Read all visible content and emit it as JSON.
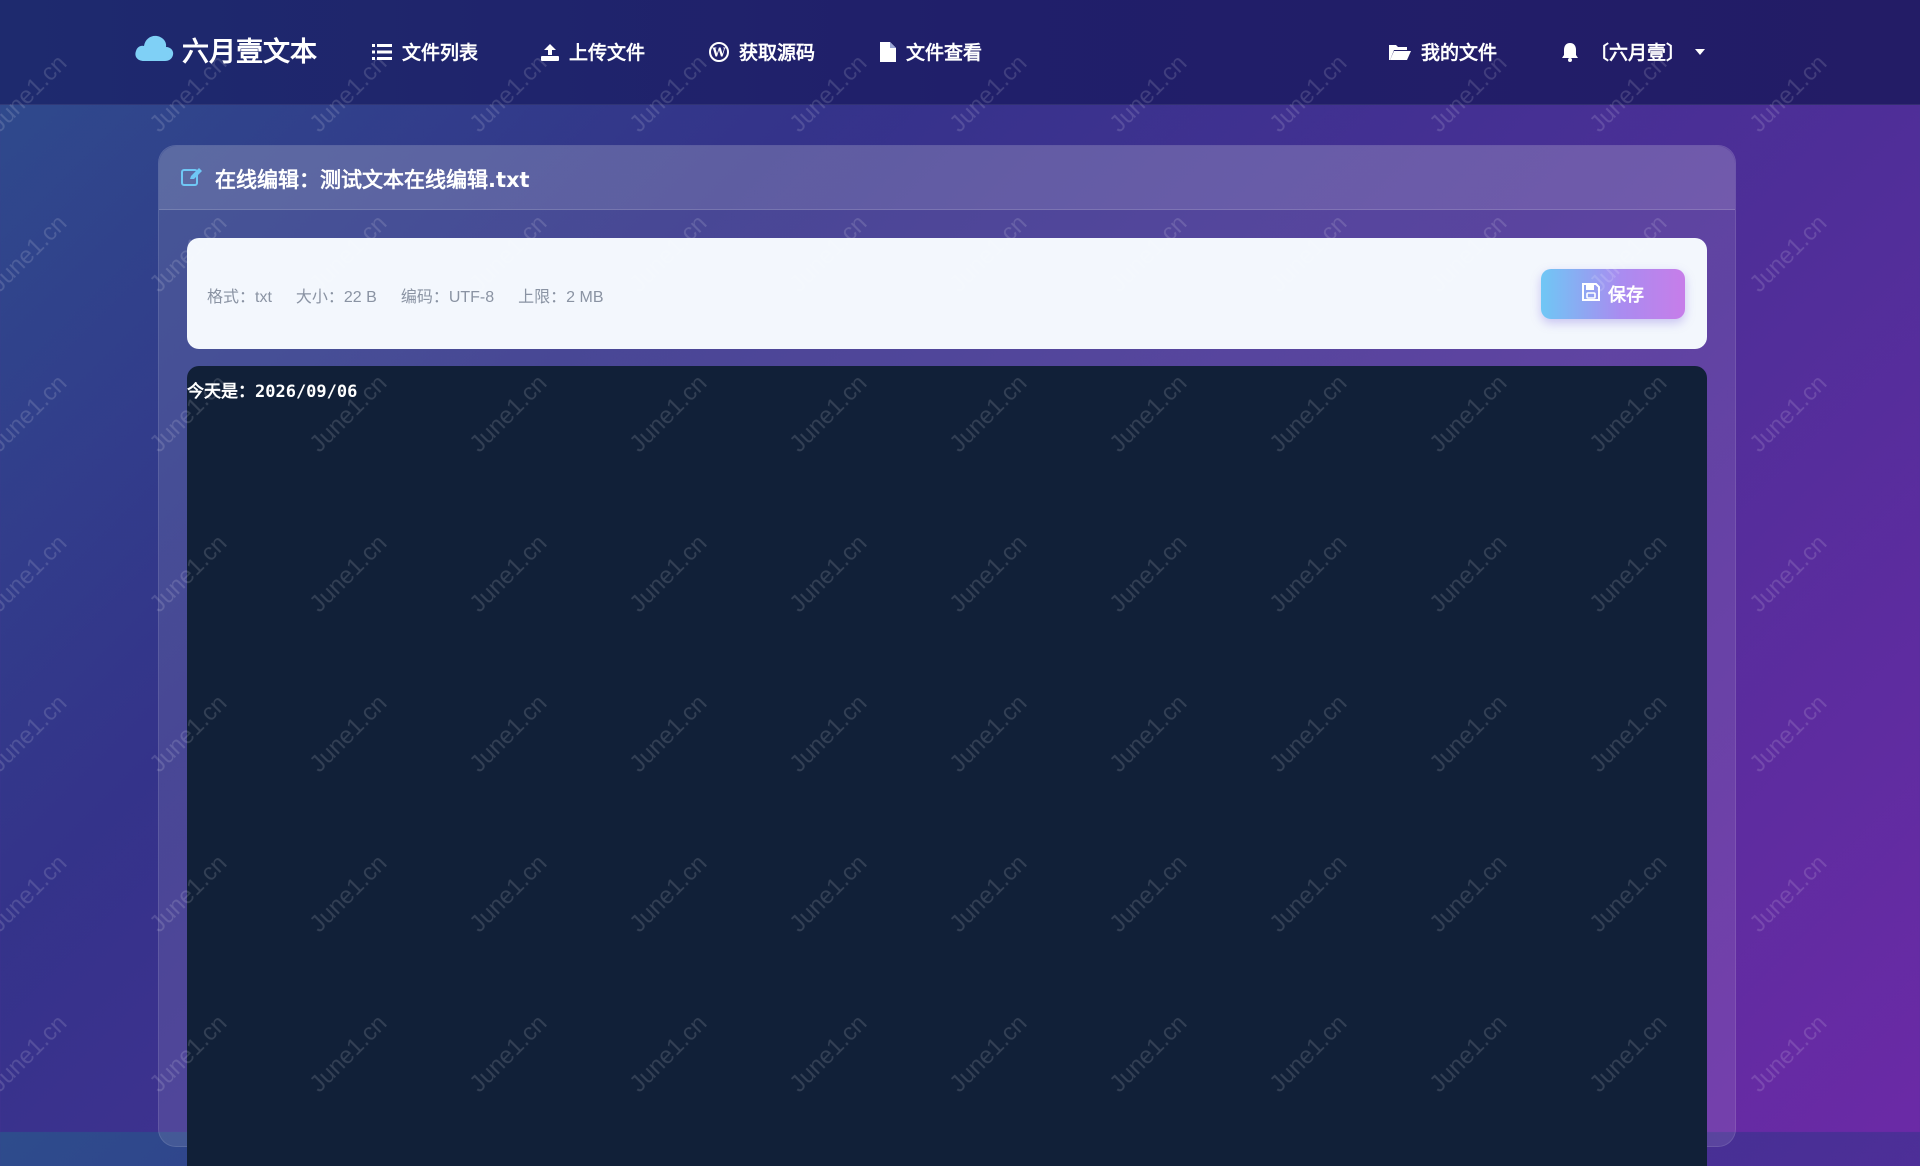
{
  "nav": {
    "brand": "六月壹文本",
    "items": [
      {
        "label": "文件列表",
        "icon": "list-icon"
      },
      {
        "label": "上传文件",
        "icon": "upload-icon"
      },
      {
        "label": "获取源码",
        "icon": "wordpress-icon"
      },
      {
        "label": "文件查看",
        "icon": "file-icon"
      }
    ],
    "right": {
      "my_files": "我的文件",
      "user": "〔六月壹〕"
    }
  },
  "editor_panel": {
    "title": "在线编辑：测试文本在线编辑.txt",
    "meta": {
      "format": "格式：txt",
      "size": "大小：22 B",
      "encoding": "编码：UTF-8",
      "limit": "上限：2 MB"
    },
    "save_label": "保存",
    "content": "今天是：2026/09/06"
  },
  "watermark": "June1.cn",
  "colors": {
    "navbar": "#1e2a6e",
    "editor_bg": "#112038",
    "toolbar_bg": "#f3f7fd",
    "accent_cyan": "#6fc7f5",
    "accent_purple": "#c77de9",
    "cloud": "#7fd0f6"
  }
}
